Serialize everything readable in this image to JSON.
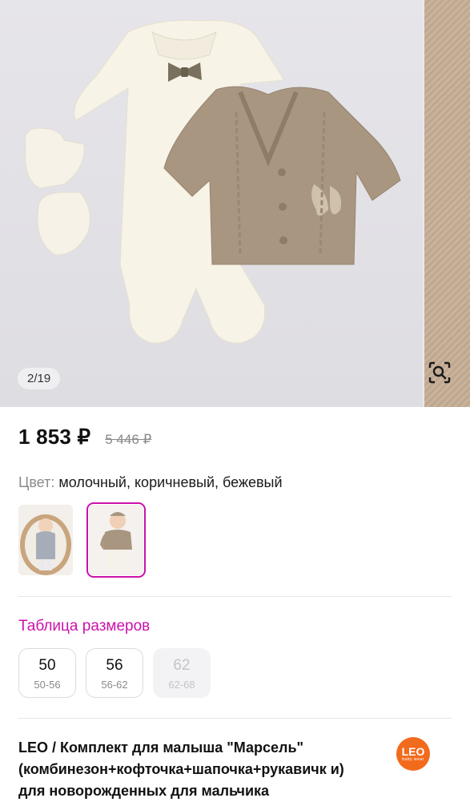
{
  "gallery": {
    "counter": "2/19",
    "main_image_alt": "",
    "visual_search_icon": "image-search-icon"
  },
  "price": {
    "current": "1 853 ₽",
    "old": "5 446 ₽"
  },
  "color": {
    "label": "Цвет:",
    "value": "молочный, коричневый, бежевый"
  },
  "variants": [
    {
      "name": "variant-grey",
      "selected": false
    },
    {
      "name": "variant-brown",
      "selected": true
    }
  ],
  "size_table": {
    "label": "Таблица размеров"
  },
  "sizes": [
    {
      "size": "50",
      "range": "50-56",
      "available": true
    },
    {
      "size": "56",
      "range": "56-62",
      "available": true
    },
    {
      "size": "62",
      "range": "62-68",
      "available": false
    }
  ],
  "product": {
    "title": "LEO / Комплект для малыша \"Марсель\" (комбинезон+кофточка+шапочка+рукавичк и) для новорожденных для мальчика",
    "brand_logo_text": "LEO",
    "brand_logo_subtext": "baby wear"
  },
  "colors": {
    "accent": "#cb11ab",
    "brand_logo": "#f26b1d"
  }
}
